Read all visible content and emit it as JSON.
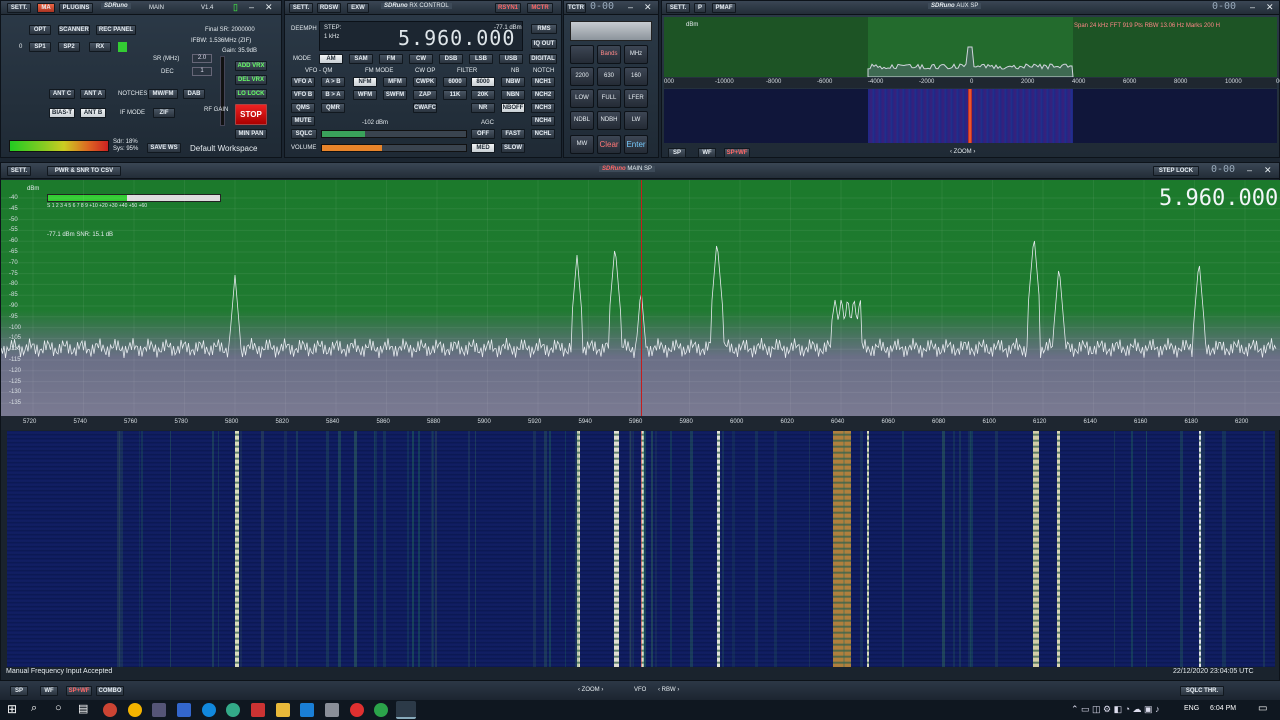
{
  "main_panel": {
    "settings": "SETT.",
    "ma": "MA",
    "plugins": "PLUGINS",
    "brand": "SDRuno",
    "tag": "MAIN",
    "version": "V1.4",
    "buttons": [
      "OPT",
      "SCANNER",
      "REC PANEL"
    ],
    "sp_buttons": [
      "SP1",
      "SP2",
      "RX"
    ],
    "sp_count": "0",
    "final_sr": "Final SR: 2000000",
    "ifbw": "IFBW: 1.536MHz (ZIF)",
    "gain": "Gain: 35.9dB",
    "sr_label": "SR (MHz)",
    "sr_value": "2.0",
    "dec_label": "DEC",
    "dec_value": "1",
    "vrx": [
      "ADD VRX",
      "DEL VRX",
      "LO LOCK"
    ],
    "ant": [
      "ANT C",
      "ANT A"
    ],
    "notches": "NOTCHES",
    "mwfm": "MW/FM",
    "dab": "DAB",
    "biast": "BIAS-T",
    "antb": "ANT B",
    "ifmode": "IF MODE",
    "zif": "ZIF",
    "rfgain": "RF GAIN",
    "stop": "STOP",
    "minpan": "MIN PAN",
    "sdr": "Sdr: 18%",
    "sys": "Sys: 95%",
    "savews": "SAVE WS",
    "workspace": "Default Workspace"
  },
  "rx_panel": {
    "settings": "SETT.",
    "rdsw": "RDSW",
    "exw": "EXW",
    "brand": "SDRuno",
    "tag": "RX CONTROL",
    "rsyn": "RSYN1",
    "mctr": "MCTR",
    "tctr": "TCTR",
    "deemph": "DEEMPH",
    "step": "STEP:",
    "step_val": "1 kHz",
    "frequency": "5.960.000",
    "signal": "-77.1 dBm",
    "rms": "RMS",
    "iqout": "IQ OUT",
    "mode_label": "MODE",
    "modes": [
      "AM",
      "SAM",
      "FM",
      "CW",
      "DSB",
      "LSB",
      "USB",
      "DIGITAL"
    ],
    "vfo_label": "VFO - QM",
    "fm_mode": "FM MODE",
    "cw_op": "CW OP",
    "filter": "FILTER",
    "nb": "NB",
    "notch": "NOTCH",
    "row1": [
      "VFO A",
      "A > B",
      "NFM",
      "MFM",
      "CWPK",
      "6000",
      "8000",
      "NBW",
      "NCH1"
    ],
    "row2": [
      "VFO B",
      "B > A",
      "WFM",
      "SWFM",
      "ZAP",
      "11K",
      "20K",
      "NBN",
      "NCH2"
    ],
    "row3": [
      "QMS",
      "QMR",
      "CWAFC",
      "NR",
      "NBOFF",
      "NCH3"
    ],
    "row4": [
      "MUTE",
      "NCH4"
    ],
    "agc": "AGC",
    "sqlc": "SQLC",
    "sqlc_level": "-102 dBm",
    "agc_modes": [
      "OFF",
      "FAST",
      "MED",
      "SLOW"
    ],
    "nchl": "NCHL",
    "volume": "VOLUME",
    "volume_level": 0.14,
    "sqlc_fill": 0.3
  },
  "keypad": {
    "display": "0-00",
    "top": [
      "",
      "Bands",
      "MHz"
    ],
    "r1": [
      "2200",
      "630",
      "160"
    ],
    "r2": [
      "LOW",
      "FULL",
      "LFER"
    ],
    "r3": [
      "NDBL",
      "NDBH",
      "LW"
    ],
    "r4": [
      "MW",
      "Clear",
      "Enter"
    ]
  },
  "aux": {
    "settings": "SETT.",
    "p": "P",
    "pmaf": "PMAF",
    "brand": "SDRuno",
    "tag": "AUX SP",
    "display": "0-00",
    "info": "Span 24 kHz  FFT 919 Pts  RBW 13.06 Hz  Marks 200 H",
    "unit": "dBm",
    "ticks": [
      "000",
      "-10000",
      "-8000",
      "-6000",
      "-4000",
      "-2000",
      "0",
      "2000",
      "4000",
      "6000",
      "8000",
      "10000",
      "000"
    ],
    "sp": "SP",
    "wf": "WF",
    "spwf": "SP+WF",
    "zoom": "ZOOM"
  },
  "spectrum": {
    "settings": "SETT.",
    "csv": "PWR & SNR TO CSV",
    "brand": "SDRuno",
    "tag": "MAIN SP",
    "steplock": "STEP LOCK",
    "display": "0-00",
    "frequency": "5.960.000",
    "dbm": "dBm",
    "smeter": "S  1  2  3  4  5  6  7  8  9  +10  +20  +30  +40  +50  +60",
    "readout": "-77.1 dBm    SNR: 15.1 dB",
    "yticks": [
      "-40",
      "-45",
      "-50",
      "-55",
      "-60",
      "-65",
      "-70",
      "-75",
      "-80",
      "-85",
      "-90",
      "-95",
      "-100",
      "-105",
      "-110",
      "-115",
      "-120",
      "-125",
      "-130",
      "-135"
    ],
    "xticks": [
      "5720",
      "5740",
      "5760",
      "5780",
      "5800",
      "5820",
      "5840",
      "5860",
      "5880",
      "5900",
      "5920",
      "5940",
      "5960",
      "5980",
      "6000",
      "6020",
      "6040",
      "6060",
      "6080",
      "6100",
      "6120",
      "6140",
      "6160",
      "6180",
      "6200"
    ]
  },
  "status": {
    "left": "Manual Frequency Input Accepted",
    "right": "22/12/2020 23:04:05 UTC"
  },
  "bottom": {
    "sp": "SP",
    "wf": "WF",
    "spwf": "SP+WF",
    "combo": "COMBO",
    "zoom": "ZOOM",
    "vfo": "VFO",
    "rbw": "RBW",
    "sqlc": "SQLC THR."
  },
  "taskbar": {
    "lang": "ENG",
    "time": "6:04 PM"
  },
  "colors": {
    "spectrum_bg": "#1e7a2e",
    "waterfall": "#0b1a5c",
    "marker": "#c41e1e"
  }
}
